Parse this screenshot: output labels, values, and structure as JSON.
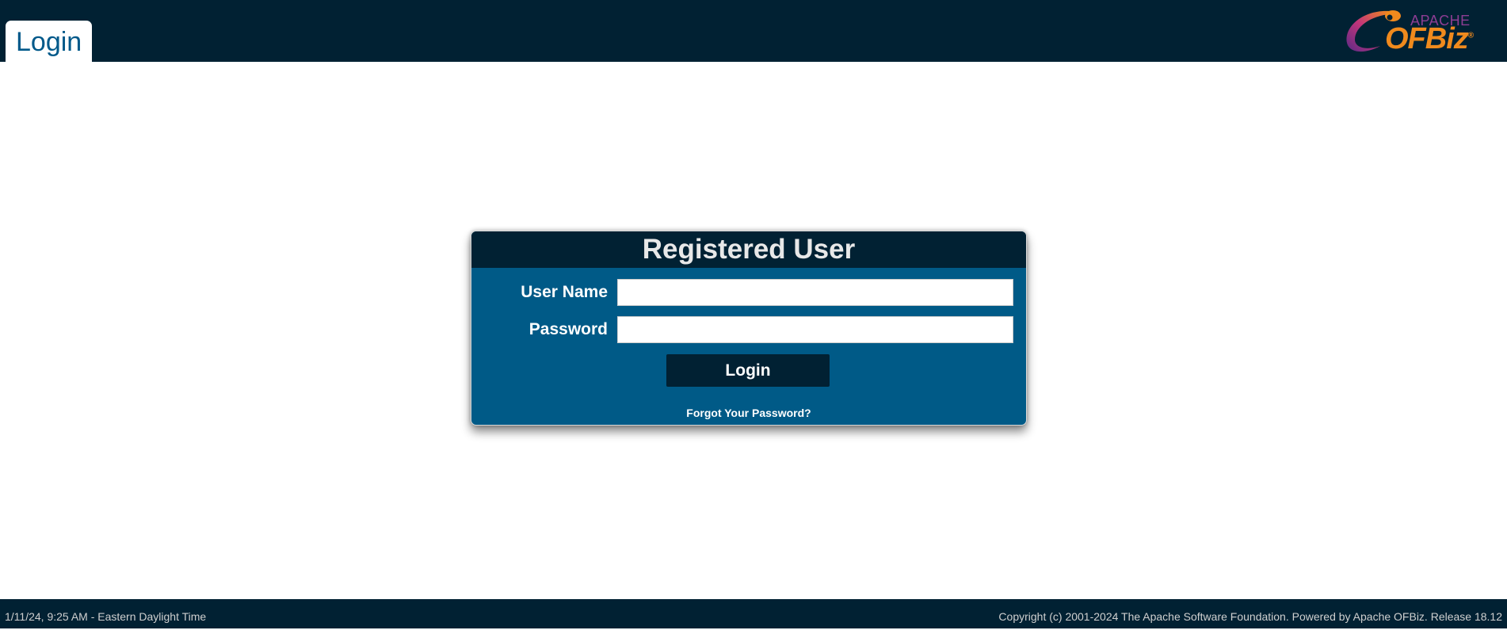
{
  "header": {
    "tab_label": "Login",
    "logo": {
      "apache_text": "APACHE",
      "ofbiz_text": "OFBiz",
      "registered_mark": "®"
    }
  },
  "login_panel": {
    "title": "Registered User",
    "username_label": "User Name",
    "username_value": "",
    "password_label": "Password",
    "password_value": "",
    "login_button": "Login",
    "forgot_link": "Forgot Your Password?"
  },
  "footer": {
    "timestamp": "1/11/24, 9:25 AM - Eastern Daylight Time",
    "copyright": "Copyright (c) 2001-2024 The Apache Software Foundation. Powered by Apache OFBiz. Release 18.12"
  },
  "colors": {
    "header_bg": "#012133",
    "panel_bg": "#005a87",
    "tab_text": "#00598a",
    "logo_orange": "#f08a1d",
    "logo_purple": "#8d3d93"
  }
}
